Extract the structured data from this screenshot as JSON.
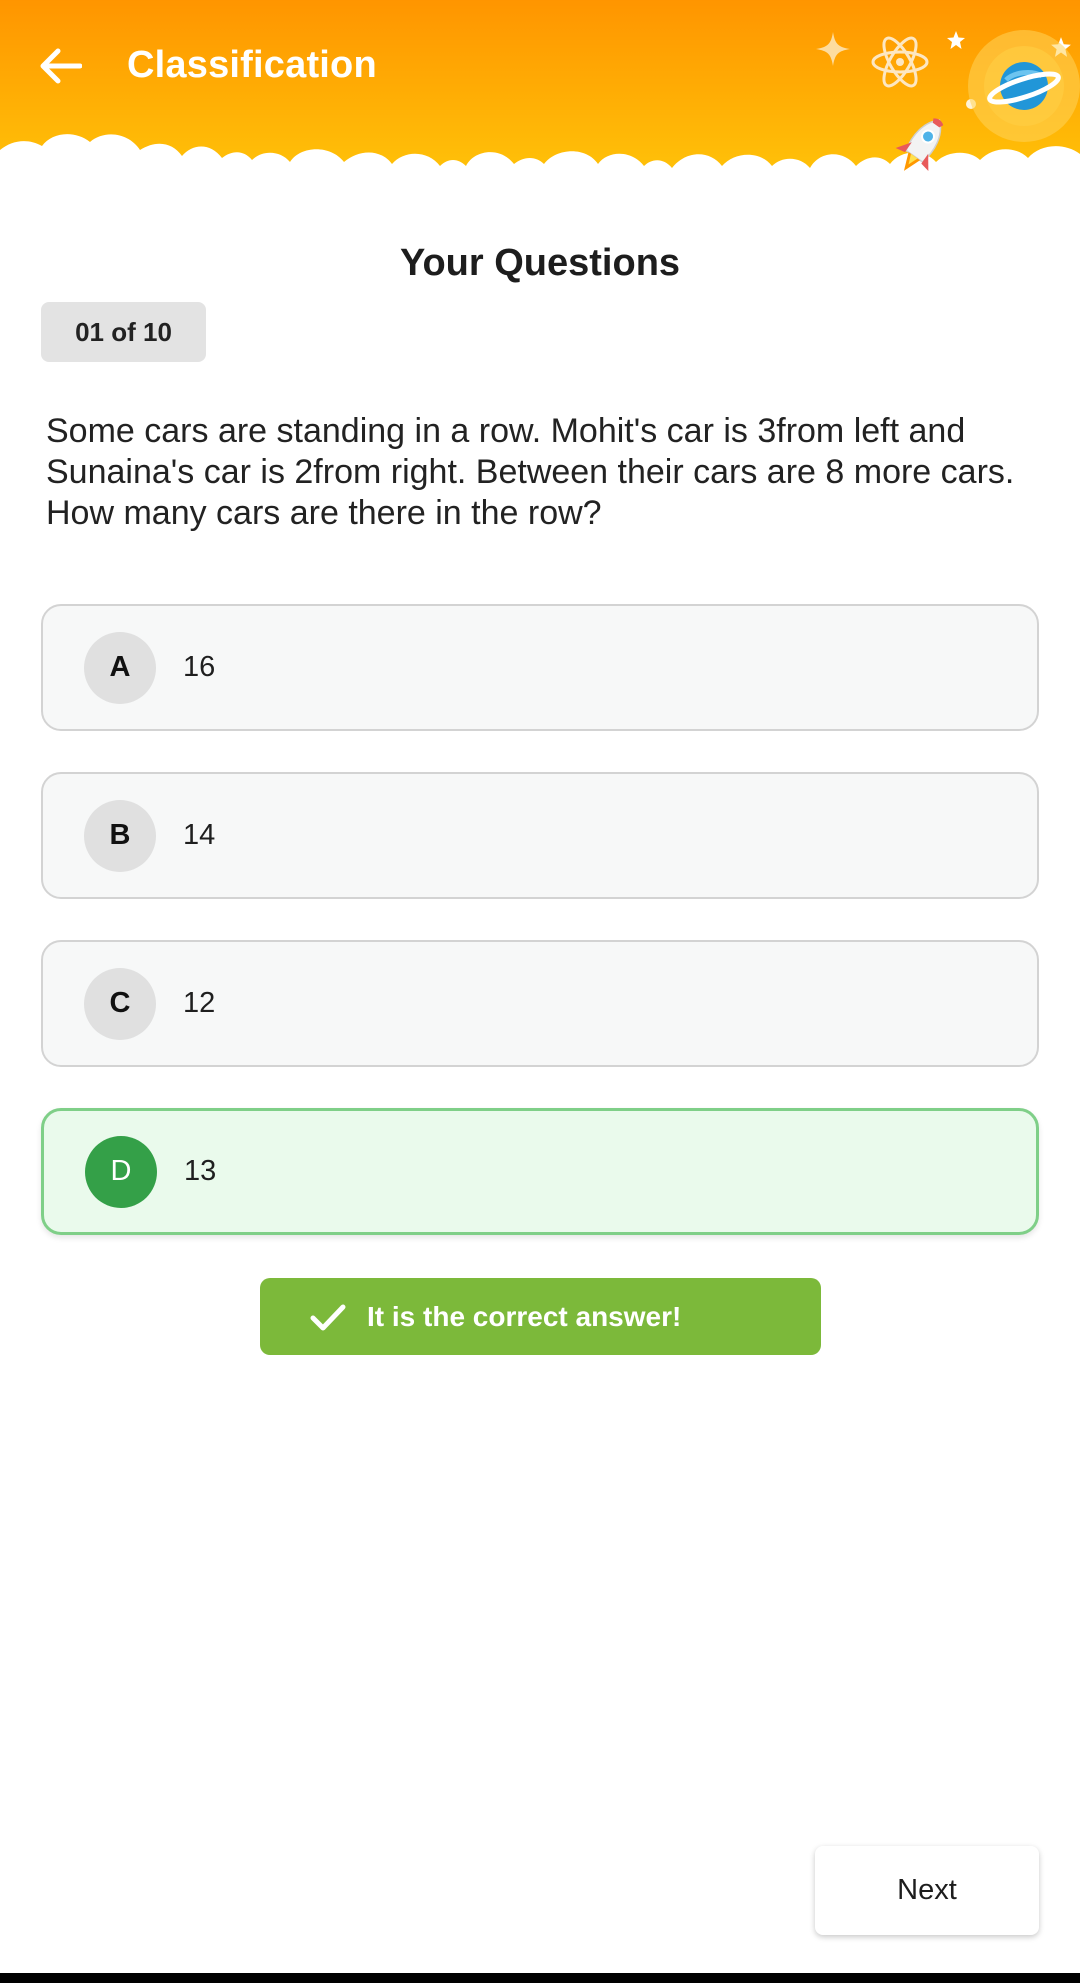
{
  "header": {
    "title": "Classification",
    "back_icon": "arrow-left-icon",
    "gradient_top": "#ff9800",
    "gradient_bottom": "#ffc107"
  },
  "main": {
    "section_title": "Your Questions",
    "counter": "01 of 10",
    "question": "Some cars are standing in a row. Mohit's car is 3from left and Sunaina's car is 2from right. Between their cars are 8 more cars. How many cars are there in the row?",
    "options": [
      {
        "letter": "A",
        "value": "16",
        "state": "default"
      },
      {
        "letter": "B",
        "value": "14",
        "state": "default"
      },
      {
        "letter": "C",
        "value": "12",
        "state": "default"
      },
      {
        "letter": "D",
        "value": "13",
        "state": "correct"
      }
    ],
    "feedback": {
      "icon": "check-icon",
      "message": "It is the correct answer!",
      "color": "#7cb93a"
    },
    "next_label": "Next"
  },
  "colors": {
    "correct_fill": "#eafaec",
    "correct_border": "#7fcf88",
    "correct_letter": "#34a048"
  }
}
